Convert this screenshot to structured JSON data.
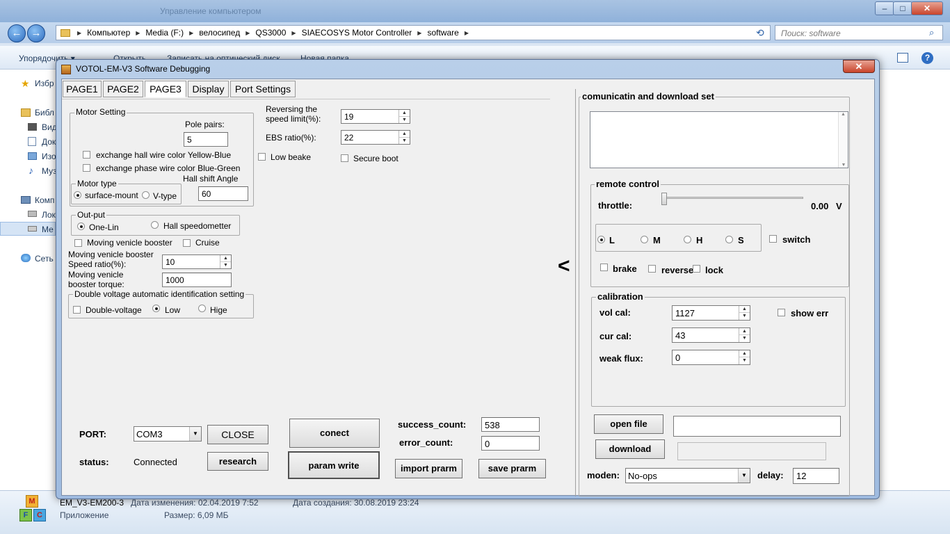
{
  "explorer": {
    "title": "Управление компьютером",
    "window_buttons": {
      "minimize": "–",
      "maximize": "□",
      "close": "✕"
    },
    "breadcrumbs": [
      "Компьютер",
      "Media (F:)",
      "велосипед",
      "QS3000",
      "SIAECOSYS Motor Controller",
      "software"
    ],
    "search_placeholder": "Поиск: software",
    "toolbar": {
      "organize": "Упорядочить ▾",
      "open": "Открыть",
      "burn": "Записать на оптический диск",
      "new_folder": "Новая папка"
    },
    "nav": [
      "Избр",
      "Библ",
      "Вид",
      "Док",
      "Изо",
      "Муз",
      "Комп",
      "Лок",
      "Ме",
      "Сеть"
    ],
    "details": {
      "file_name": "EM_V3-EM200-3",
      "modified": "Дата изменения: 02.04.2019 7:52",
      "created": "Дата создания: 30.08.2019 23:24",
      "type": "Приложение",
      "size": "Размер: 6,09 МБ"
    }
  },
  "dialog": {
    "title": "VOTOL-EM-V3 Software Debugging",
    "close": "✕",
    "tabs": [
      "PAGE1",
      "PAGE2",
      "PAGE3",
      "Display",
      "Port Settings"
    ],
    "active_tab": "PAGE3"
  },
  "motor_setting": {
    "title": "Motor Setting",
    "pole_pairs_label": "Pole pairs:",
    "pole_pairs": "5",
    "exchange_hall": "exchange hall wire color Yellow-Blue",
    "exchange_phase": "exchange phase wire color Blue-Green",
    "motor_type_title": "Motor type",
    "surface_mount": "surface-mount",
    "v_type": "V-type",
    "hall_shift_label": "Hall shift Angle",
    "hall_shift": "60"
  },
  "reversing": {
    "label_line1": "Reversing the",
    "label_line2": "speed limit(%):",
    "value": "19",
    "ebs_label": "EBS ratio(%):",
    "ebs_value": "22",
    "low_beake": "Low beake",
    "secure_boot": "Secure boot"
  },
  "output": {
    "title": "Out-put",
    "one_lin": "One-Lin",
    "hall_speedometer": "Hall speedometter",
    "moving_booster": "Moving venicle booster",
    "cruise": "Cruise",
    "speed_ratio_label1": "Moving venicle booster",
    "speed_ratio_label2": "Speed ratio(%):",
    "speed_ratio": "10",
    "torque_label1": "Moving venicle",
    "torque_label2": "booster torque:",
    "torque": "1000",
    "double_voltage_title": "Double voltage automatic identification setting",
    "double_voltage": "Double-voltage",
    "low": "Low",
    "hige": "Hige"
  },
  "bottom": {
    "port_label": "PORT:",
    "port_value": "COM3",
    "close_btn": "CLOSE",
    "status_label": "status:",
    "status_value": "Connected",
    "research_btn": "research",
    "conect_btn": "conect",
    "param_write_btn": "param write",
    "success_label": "success_count:",
    "success_value": "538",
    "error_label": "error_count:",
    "error_value": "0",
    "import_btn": "import prarm",
    "save_btn": "save prarm"
  },
  "right": {
    "collapse_arrow": "<",
    "comm_title": "comunicatin and download set",
    "remote_title": "remote control",
    "throttle_label": "throttle:",
    "throttle_value": "0.00",
    "throttle_unit": "V",
    "throttle_level": 0.0,
    "modes": [
      "L",
      "M",
      "H",
      "S"
    ],
    "selected_mode": "L",
    "switch": "switch",
    "brake": "brake",
    "reverse": "reverse",
    "lock": "lock",
    "calibration_title": "calibration",
    "vol_cal_label": "vol cal:",
    "vol_cal": "1127",
    "cur_cal_label": "cur cal:",
    "cur_cal": "43",
    "weak_flux_label": "weak flux:",
    "weak_flux": "0",
    "show_err": "show err",
    "open_file_btn": "open file",
    "download_btn": "download",
    "moden_label": "moden:",
    "moden_value": "No-ops",
    "delay_label": "delay:",
    "delay_value": "12"
  }
}
